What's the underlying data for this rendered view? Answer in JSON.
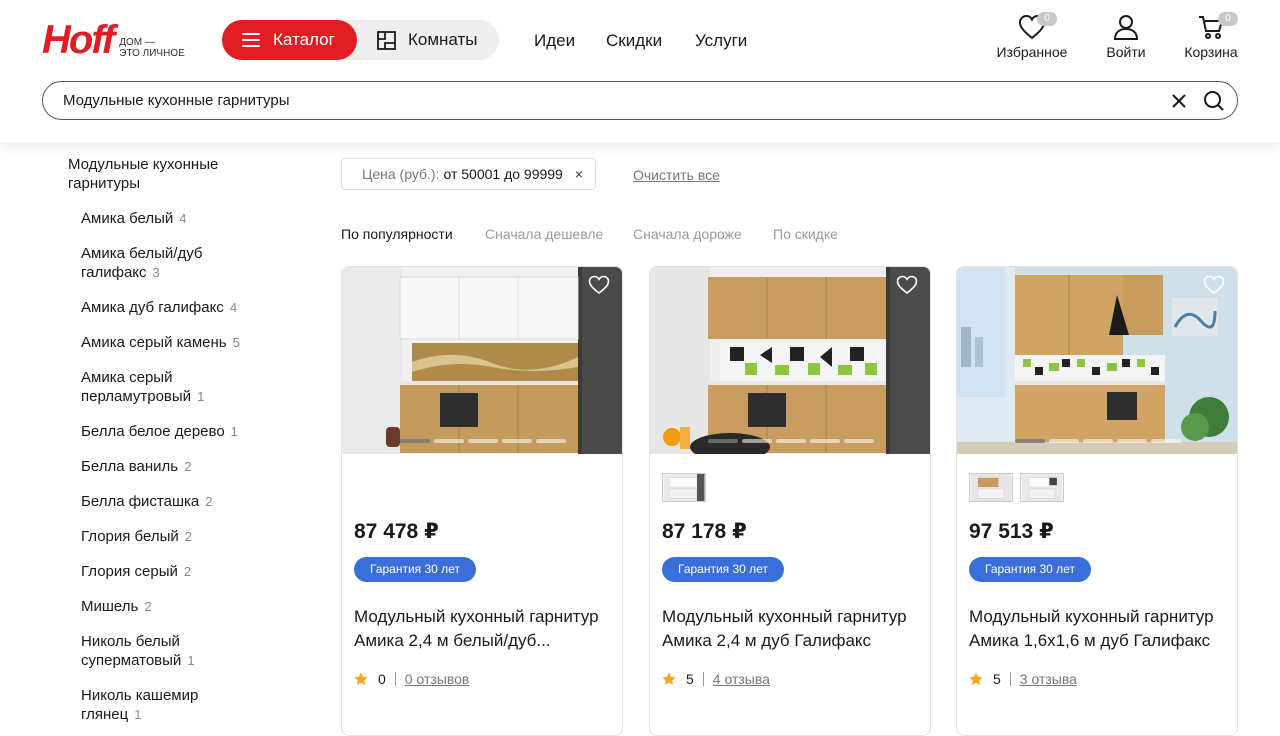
{
  "header": {
    "logo_word": "Hoff",
    "logo_tagline_1": "ДОМ —",
    "logo_tagline_2": "ЭТО ЛИЧНОЕ",
    "catalog_label": "Каталог",
    "rooms_label": "Комнаты",
    "nav": [
      "Идеи",
      "Скидки",
      "Услуги"
    ],
    "favorites_label": "Избранное",
    "favorites_count": "0",
    "login_label": "Войти",
    "cart_label": "Корзина",
    "cart_count": "0"
  },
  "search": {
    "value": "Модульные кухонные гарнитуры"
  },
  "sidebar": {
    "title": "Модульные кухонные гарнитуры",
    "items": [
      {
        "label": "Амика белый",
        "count": "4"
      },
      {
        "label": "Амика белый/дуб галифакс",
        "count": "3"
      },
      {
        "label": "Амика дуб галифакс",
        "count": "4"
      },
      {
        "label": "Амика серый камень",
        "count": "5"
      },
      {
        "label": "Амика серый перламутровый",
        "count": "1"
      },
      {
        "label": "Белла белое дерево",
        "count": "1"
      },
      {
        "label": "Белла ваниль",
        "count": "2"
      },
      {
        "label": "Белла фисташка",
        "count": "2"
      },
      {
        "label": "Глория белый",
        "count": "2"
      },
      {
        "label": "Глория серый",
        "count": "2"
      },
      {
        "label": "Мишель",
        "count": "2"
      },
      {
        "label": "Николь белый суперматовый",
        "count": "1"
      },
      {
        "label": "Николь кашемир глянец",
        "count": "1"
      }
    ]
  },
  "filters": {
    "chip_key": "Цена (руб.):",
    "chip_value": "от 50001 до 99999",
    "chip_remove": "×",
    "clear_all": "Очистить все"
  },
  "sort": {
    "options": [
      "По популярности",
      "Сначала дешевле",
      "Сначала дороже",
      "По скидке"
    ],
    "active": "По популярности"
  },
  "products": [
    {
      "price": "87 478 ₽",
      "warranty": "Гарантия 30 лет",
      "name_line1": "Модульный кухонный гарнитур",
      "name_line2": "Амика 2,4 м белый/дуб...",
      "rating": "0",
      "reviews": "0 отзывов"
    },
    {
      "price": "87 178 ₽",
      "warranty": "Гарантия 30 лет",
      "name_line1": "Модульный кухонный гарнитур",
      "name_line2": "Амика 2,4 м дуб Галифакс",
      "rating": "5",
      "reviews": "4 отзыва"
    },
    {
      "price": "97 513 ₽",
      "warranty": "Гарантия 30 лет",
      "name_line1": "Модульный кухонный гарнитур",
      "name_line2": "Амика 1,6х1,6 м дуб Галифакс",
      "rating": "5",
      "reviews": "3 отзыва"
    }
  ],
  "colors": {
    "brand_red": "#e11c23",
    "warranty_blue": "#3b6fd8",
    "star_orange": "#f5a623"
  }
}
